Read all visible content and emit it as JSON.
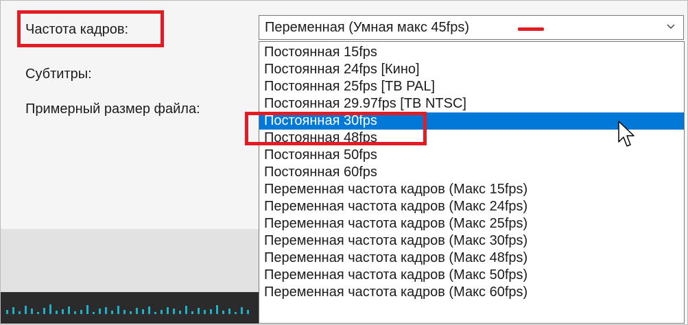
{
  "fields": {
    "frame_rate_label": "Частота кадров:",
    "subtitles_label": "Субтитры:",
    "file_size_label": "Примерный размер файла:"
  },
  "frame_rate_combo": {
    "selected_value": "Переменная (Умная макс 45fps)",
    "arrow_icon": "chevron-down-icon"
  },
  "dropdown": {
    "highlighted_index": 4,
    "options": [
      "Постоянная 15fps",
      "Постоянная 24fps [Кино]",
      "Постоянная 25fps [ТВ PAL]",
      "Постоянная 29.97fps [ТВ NTSC]",
      "Постоянная 30fps",
      "Постоянная 48fps",
      "Постоянная 50fps",
      "Постоянная 60fps",
      "Переменная частота кадров (Макс 15fps)",
      "Переменная частота кадров (Макс 24fps)",
      "Переменная частота кадров (Макс 25fps)",
      "Переменная частота кадров (Макс 30fps)",
      "Переменная частота кадров (Макс 48fps)",
      "Переменная частота кадров (Макс 50fps)",
      "Переменная частота кадров (Макс 60fps)"
    ]
  },
  "colors": {
    "highlight": "#0078d7",
    "annotation": "#e31b23",
    "waveform": "#1cb3c8"
  },
  "cursor_icon": "mouse-pointer-icon"
}
